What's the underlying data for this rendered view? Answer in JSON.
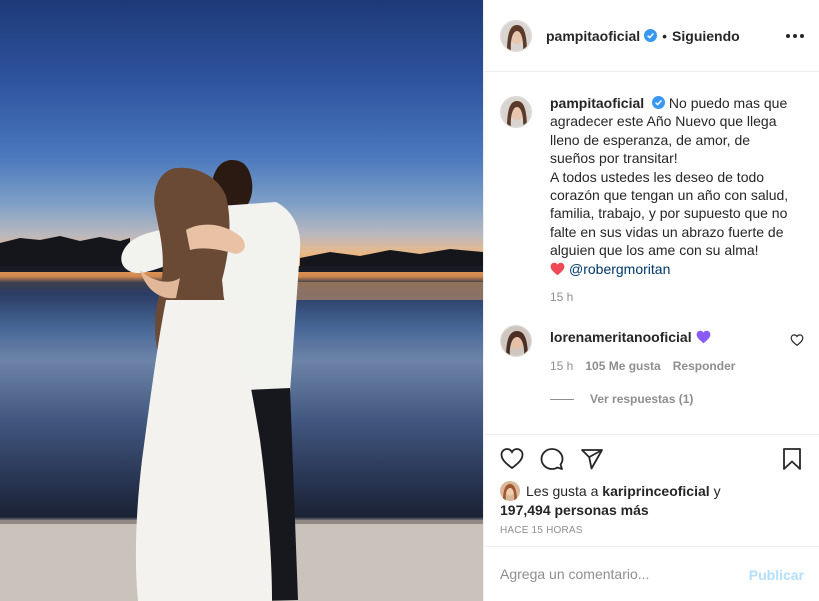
{
  "post": {
    "username": "pampitaoficial",
    "follow_status": "Siguiendo",
    "separator": "•",
    "caption": {
      "lines": [
        "No puedo mas que",
        "agradecer este Año Nuevo que llega",
        "lleno de esperanza, de amor, de",
        "sueños por transitar!",
        "A todos ustedes les deseo de todo",
        "corazón que tengan un año con salud,",
        "familia, trabajo, y por supuesto que no",
        "falte en sus vidas un abrazo fuerte de",
        "alguien que los ame con su alma!"
      ],
      "mention": "@robergmoritan",
      "time": "15 h"
    },
    "comment": {
      "username": "lorenameritanooficial",
      "time": "15 h",
      "likes": "105 Me gusta",
      "reply_label": "Responder",
      "view_replies": "Ver respuestas (1)"
    },
    "likes": {
      "prefix": "Les gusta a",
      "user": "kariprinceoficial",
      "conj": "y",
      "others": "197,494 personas más"
    },
    "time_ago": "HACE 15 HORAS",
    "add_comment": {
      "placeholder": "Agrega un comentario...",
      "publish": "Publicar"
    }
  },
  "colors": {
    "verified": "#3897f0",
    "mention": "#00376b",
    "publish_disabled": "#b2dffc",
    "secondary": "#8e8e8e",
    "heart_red": "#ed4956",
    "heart_purple": "#8a5cf5"
  },
  "icons": [
    "more-options-icon",
    "verified-badge-icon",
    "heart-icon",
    "comment-icon",
    "share-icon",
    "save-icon",
    "red-heart-emoji",
    "purple-heart-emoji"
  ]
}
